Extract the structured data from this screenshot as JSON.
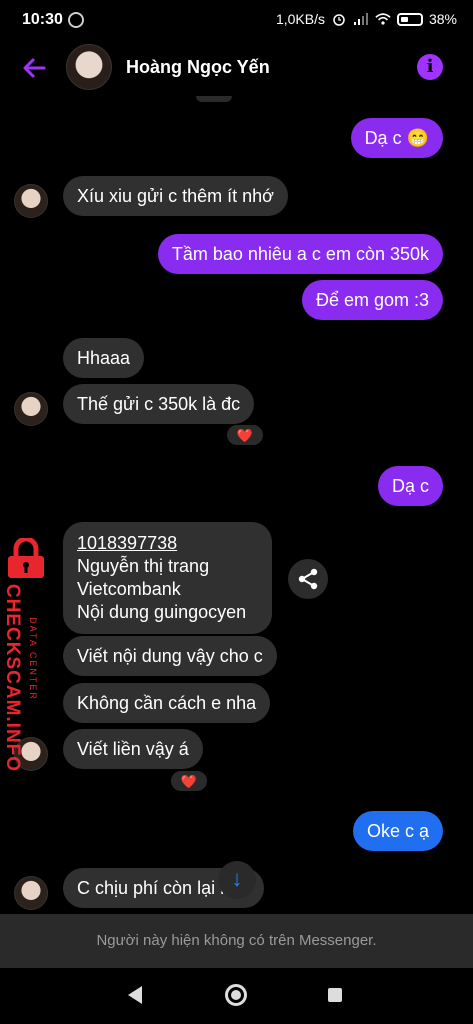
{
  "status_bar": {
    "time": "10:30",
    "network_speed": "1,0KB/s",
    "battery_percent": "38%",
    "icons": [
      "sync-icon",
      "alarm-icon",
      "signal-icon",
      "wifi-icon",
      "battery-icon"
    ]
  },
  "header": {
    "contact_name": "Hoàng Ngọc Yến",
    "info_glyph": "i",
    "accent_color": "#a033ff"
  },
  "messages": {
    "m1": "Dạ c 😁",
    "m2": "Xíu xiu gửi c thêm ít nhớ",
    "m3": "Tầm bao nhiêu a c em còn 350k",
    "m4": "Để em gom :3",
    "m5": "Hhaaa",
    "m6": "Thế gửi c 350k là đc",
    "m7": "Dạ c",
    "m8_line1": "1018397738",
    "m8_line2": "Nguyễn thị trang",
    "m8_line3": "Vietcombank",
    "m8_line4": "Nội dung guingocyen",
    "m9": "Viết nội dung vậy cho c",
    "m10": "Không cần cách e nha",
    "m11": "Viết liền vậy á",
    "m12": "Oke c ạ",
    "m13": "C chịu phí còn lại nho"
  },
  "reactions": {
    "r1": "❤️",
    "r2": "❤️"
  },
  "watermark": {
    "brand": "CHECKSCAM.INFO",
    "tagline": "DATA CENTER"
  },
  "notice": "Người này hiện không có trên Messenger.",
  "colors": {
    "outgoing_purple": "#8a2bf0",
    "outgoing_blue": "#1f6ff0",
    "incoming_gray": "#303030",
    "watermark_red": "#e8262e"
  }
}
